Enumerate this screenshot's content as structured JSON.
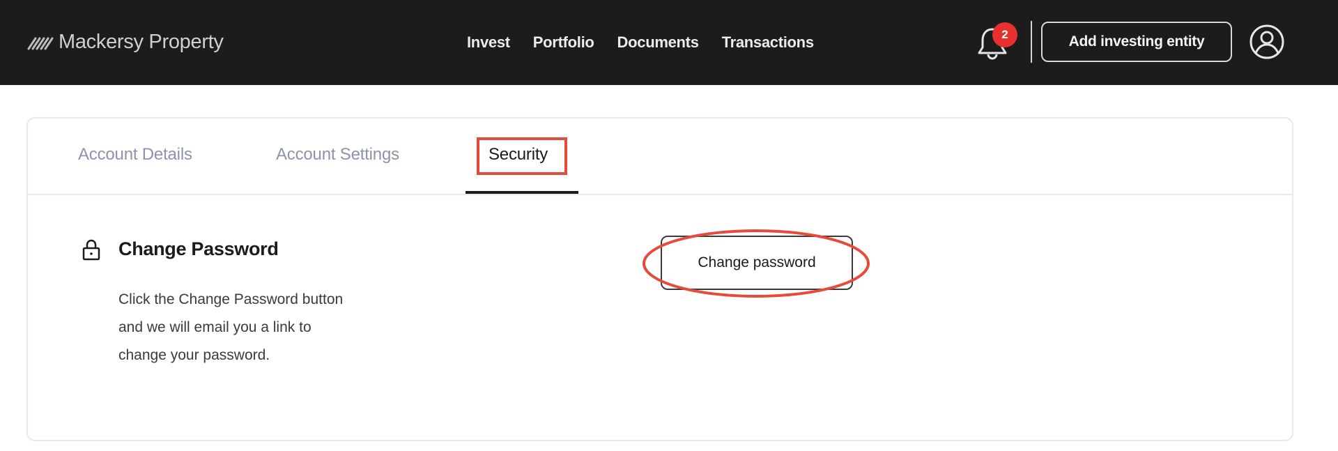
{
  "header": {
    "brand": "Mackersy Property",
    "nav": [
      {
        "label": "Invest"
      },
      {
        "label": "Portfolio"
      },
      {
        "label": "Documents"
      },
      {
        "label": "Transactions"
      }
    ],
    "notifications": {
      "icon": "bell-icon",
      "count": "2"
    },
    "add_entity_label": "Add investing entity",
    "account_icon": "user-circle-icon"
  },
  "tabs": [
    {
      "label": "Account Details",
      "active": false
    },
    {
      "label": "Account Settings",
      "active": false
    },
    {
      "label": "Security",
      "active": true
    }
  ],
  "security": {
    "icon": "lock-icon",
    "title": "Change Password",
    "description_lines": [
      "Click the Change Password button",
      "and we will email you a link to",
      "change your password."
    ],
    "button_label": "Change password"
  },
  "colors": {
    "header_bg": "#1c1c1c",
    "badge": "#e8312f",
    "annotation": "#e84a3a",
    "inactive_tab": "#8d93a8",
    "card_border": "#e6e8f2"
  }
}
